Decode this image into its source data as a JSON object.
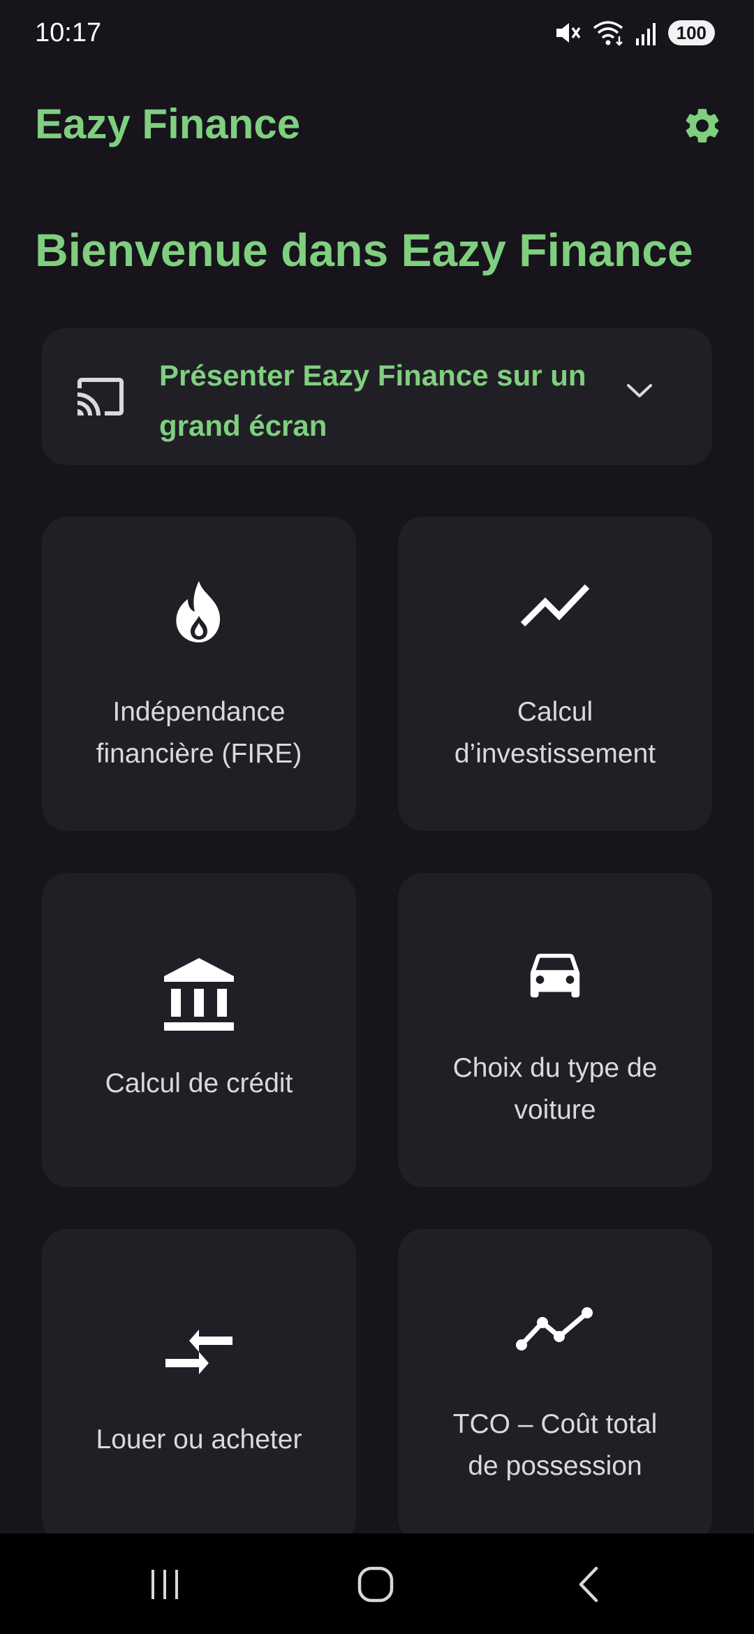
{
  "status_bar": {
    "time": "10:17",
    "battery": "100",
    "icons": [
      "mute-icon",
      "wifi-icon",
      "signal-icon",
      "battery-icon"
    ]
  },
  "app_bar": {
    "title": "Eazy Finance",
    "settings_icon": "gear-icon"
  },
  "welcome_title": "Bienvenue dans Eazy Finance",
  "cast_card": {
    "icon": "cast-icon",
    "label": "Présenter Eazy Finance sur un grand écran",
    "chevron": "chevron-down-icon"
  },
  "tiles": [
    {
      "label": "Indépendance\nfinancière (FIRE)",
      "icon": "fire-icon"
    },
    {
      "label": "Calcul\nd’investissement",
      "icon": "trending-up-icon"
    },
    {
      "label": "Calcul de crédit",
      "icon": "bank-icon"
    },
    {
      "label": "Choix du type de\nvoiture",
      "icon": "car-icon"
    },
    {
      "label": "Louer ou acheter",
      "icon": "compare-arrows-icon"
    },
    {
      "label": "TCO – Coût total\nde possession",
      "icon": "multiline-chart-icon"
    }
  ],
  "nav_bar": {
    "buttons": [
      "recent-apps-icon",
      "home-icon",
      "back-icon"
    ]
  },
  "colors": {
    "background": "#17141c",
    "card": "#211f26",
    "accent": "#7fcf7f",
    "text": "#dcd8df"
  }
}
